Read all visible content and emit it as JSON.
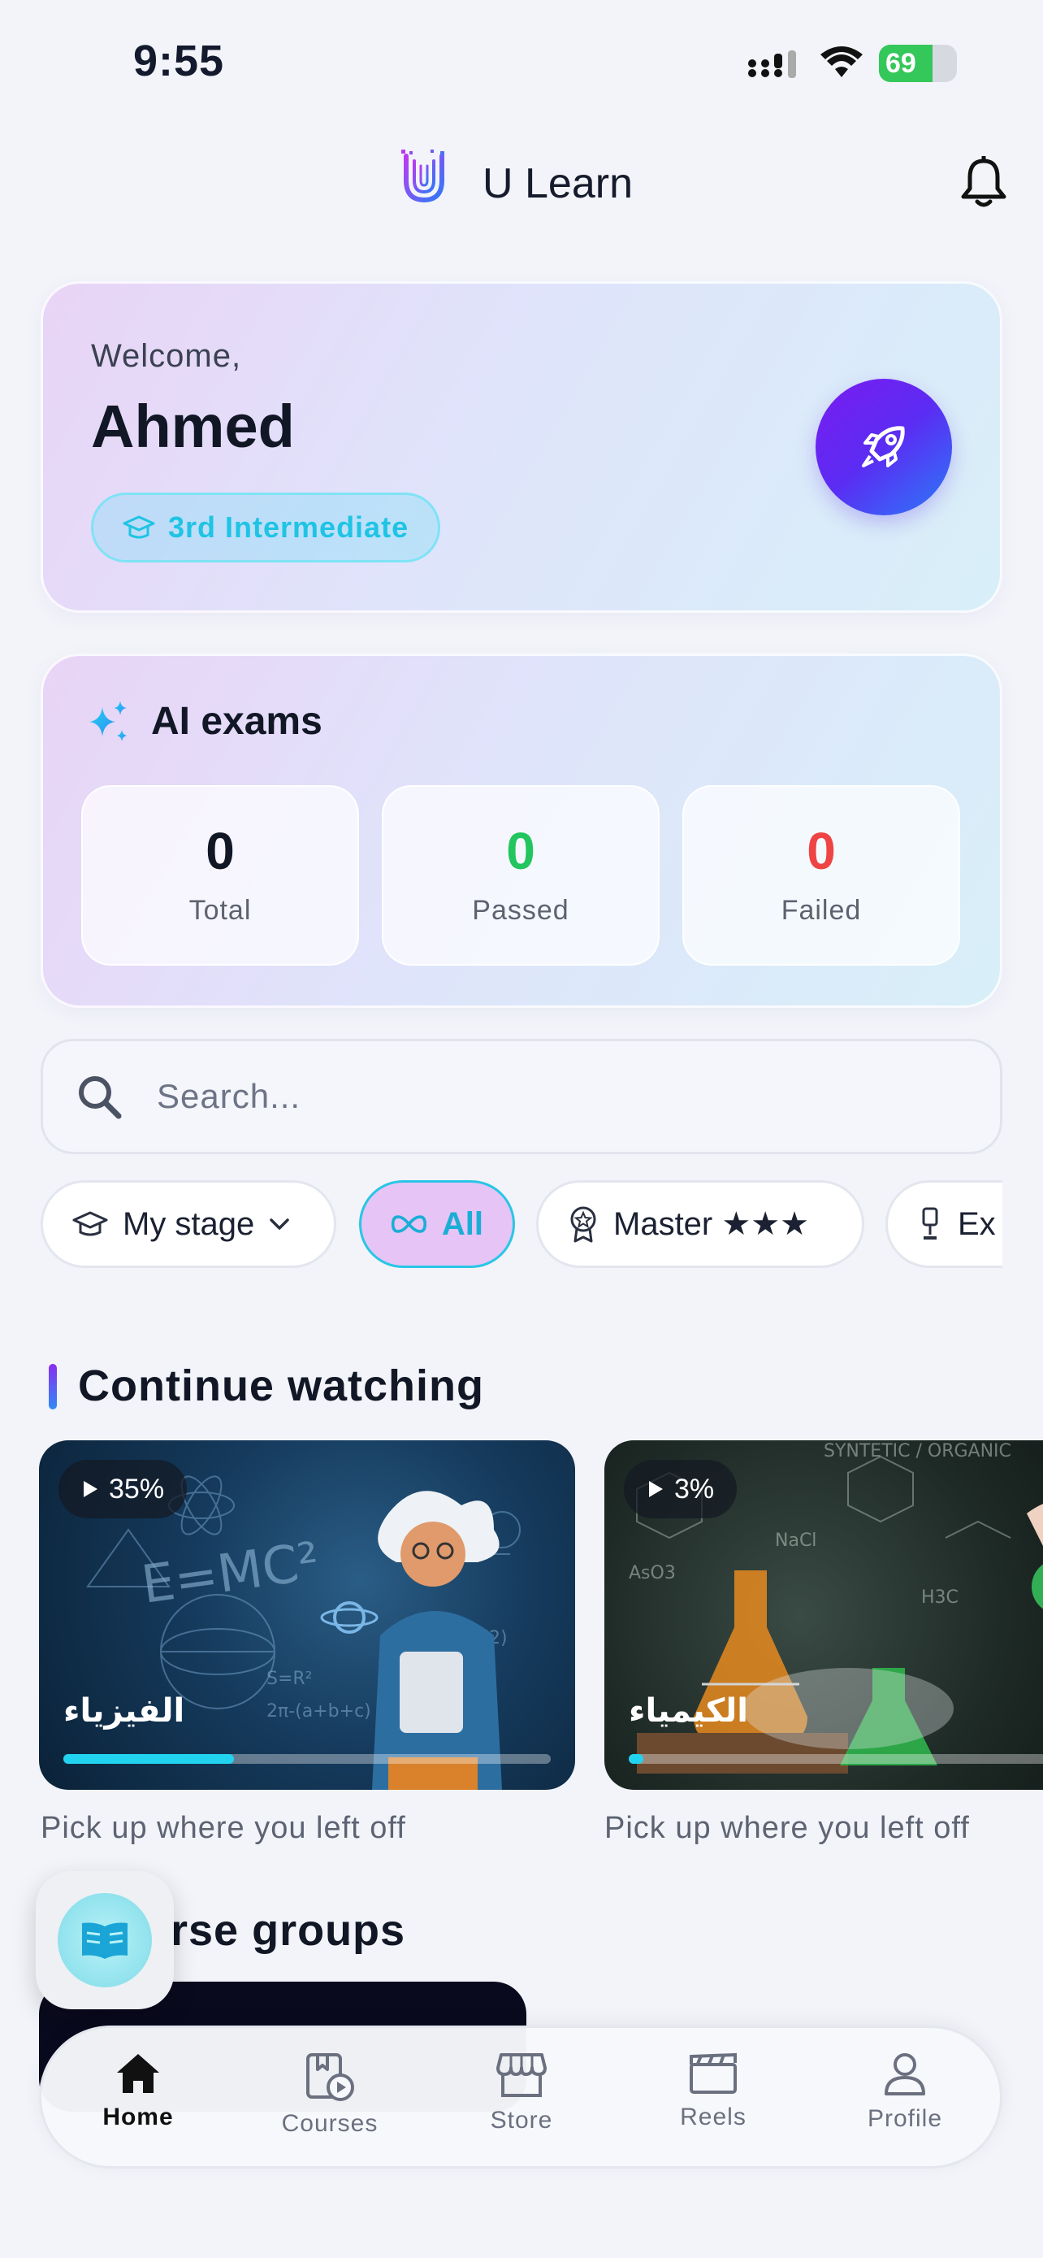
{
  "status_bar": {
    "time": "9:55",
    "battery": "69"
  },
  "header": {
    "app_title": "U Learn",
    "logo_icon": "u-learn-logo-icon",
    "notification_icon": "bell-icon"
  },
  "welcome": {
    "greeting": "Welcome,",
    "name": "Ahmed",
    "stage": "3rd Intermediate"
  },
  "ai_exams": {
    "title": "AI exams",
    "stats": [
      {
        "value": "0",
        "label": "Total",
        "color": "#121726"
      },
      {
        "value": "0",
        "label": "Passed",
        "color": "#22c55e"
      },
      {
        "value": "0",
        "label": "Failed",
        "color": "#ef4444"
      }
    ]
  },
  "search": {
    "placeholder": "Search..."
  },
  "filters": {
    "chips": [
      {
        "label": "My stage",
        "icon": "graduation-cap-icon",
        "dropdown": true
      },
      {
        "label": "All",
        "icon": "infinity-icon",
        "active": true
      },
      {
        "label": "Master ★★★",
        "icon": "award-icon"
      },
      {
        "label": "Ex",
        "icon": "trophy-icon"
      }
    ]
  },
  "continue_watching": {
    "title": "Continue watching",
    "items": [
      {
        "progress_text": "35%",
        "progress": 0.35,
        "title": "الفيزياء",
        "subtitle": "Pick up where you left off"
      },
      {
        "progress_text": "3%",
        "progress": 0.03,
        "title": "الكيمياء",
        "subtitle": "Pick up where you left off"
      }
    ]
  },
  "course_groups": {
    "title": "rse groups"
  },
  "bottom_nav": {
    "tabs": [
      {
        "label": "Home",
        "icon": "home-icon",
        "active": true
      },
      {
        "label": "Courses",
        "icon": "courses-icon"
      },
      {
        "label": "Store",
        "icon": "store-icon"
      },
      {
        "label": "Reels",
        "icon": "reels-icon"
      },
      {
        "label": "Profile",
        "icon": "profile-icon"
      }
    ]
  }
}
